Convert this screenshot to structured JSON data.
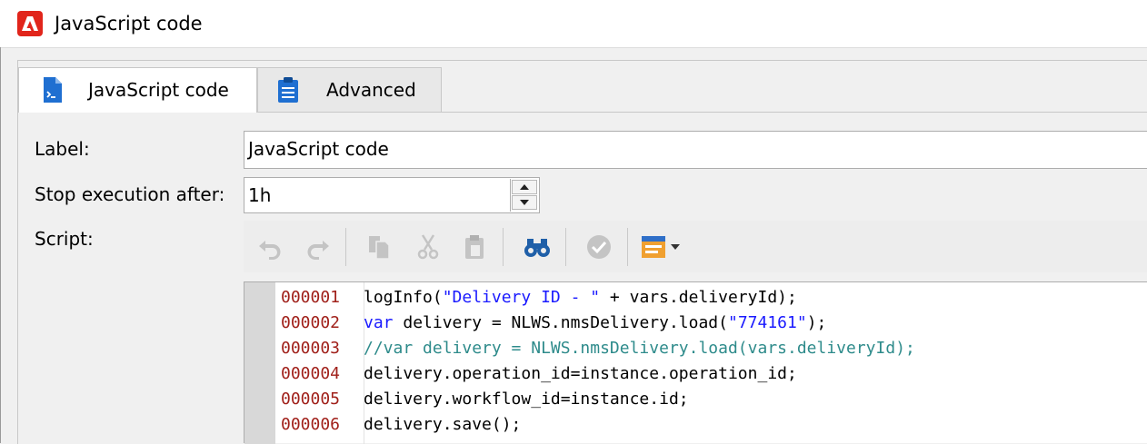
{
  "window": {
    "title": "JavaScript code"
  },
  "tabs": [
    {
      "label": "JavaScript code",
      "icon": "script-doc-icon",
      "active": true
    },
    {
      "label": "Advanced",
      "icon": "clipboard-list-icon",
      "active": false
    }
  ],
  "form": {
    "label_caption": "Label:",
    "label_value": "JavaScript code",
    "stop_caption": "Stop execution after:",
    "stop_value": "1h",
    "script_caption": "Script:"
  },
  "toolbar": {
    "buttons": [
      "undo-icon",
      "redo-icon",
      "copy-icon",
      "cut-icon",
      "paste-icon",
      "find-binoculars-icon",
      "check-syntax-icon",
      "insert-menu-icon"
    ]
  },
  "code": {
    "lines": [
      {
        "num": "000001",
        "parts": [
          {
            "t": "logInfo(",
            "c": "plain"
          },
          {
            "t": "\"Delivery ID - \"",
            "c": "str"
          },
          {
            "t": " + vars.deliveryId);",
            "c": "plain"
          }
        ]
      },
      {
        "num": "000002",
        "parts": [
          {
            "t": "var",
            "c": "kw"
          },
          {
            "t": " delivery = NLWS.nmsDelivery.load(",
            "c": "plain"
          },
          {
            "t": "\"774161\"",
            "c": "str"
          },
          {
            "t": ");",
            "c": "plain"
          }
        ]
      },
      {
        "num": "000003",
        "parts": [
          {
            "t": "//var delivery = NLWS.nmsDelivery.load(vars.deliveryId);",
            "c": "cmt"
          }
        ]
      },
      {
        "num": "000004",
        "parts": [
          {
            "t": "delivery.operation_id=instance.operation_id;",
            "c": "plain"
          }
        ]
      },
      {
        "num": "000005",
        "parts": [
          {
            "t": "delivery.workflow_id=instance.id;",
            "c": "plain"
          }
        ]
      },
      {
        "num": "000006",
        "parts": [
          {
            "t": "delivery.save();",
            "c": "plain"
          }
        ]
      }
    ]
  },
  "colors": {
    "brand": "#e1251b",
    "toolbar_icon_active": "#1f5fa8",
    "line_number": "#a0201a"
  }
}
